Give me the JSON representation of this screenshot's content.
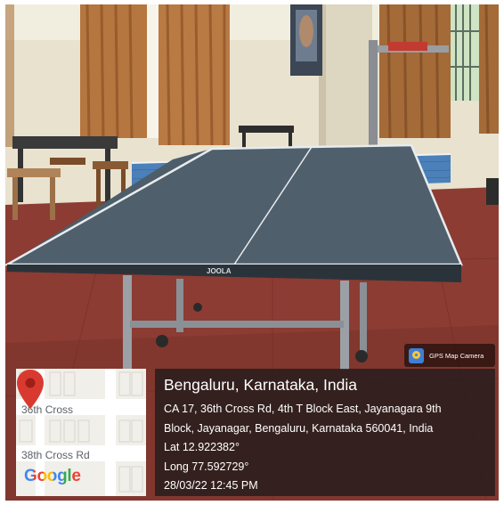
{
  "badge": {
    "app_name": "GPS Map Camera",
    "icon": "gps-map-camera-logo-icon"
  },
  "table_brand": "JOOLA",
  "map": {
    "street_1": "36th Cross",
    "street_2": "38th Cross Rd",
    "logo_text": "Google",
    "pin_icon": "map-pin-icon",
    "pin_color": "#d93a2f"
  },
  "location": {
    "title": "Bengaluru, Karnataka, India",
    "address_line_1": "CA 17, 36th Cross Rd, 4th T Block East, Jayanagara 9th",
    "address_line_2": "Block, Jayanagar, Bengaluru, Karnataka 560041, India",
    "latitude": "Lat 12.922382°",
    "longitude": "Long 77.592729°",
    "datetime": "28/03/22 12:45 PM"
  },
  "colors": {
    "table_top": "#4a5a66",
    "floor": "#8a3a32",
    "net": "#2f6fb5",
    "panel": "#191919"
  }
}
